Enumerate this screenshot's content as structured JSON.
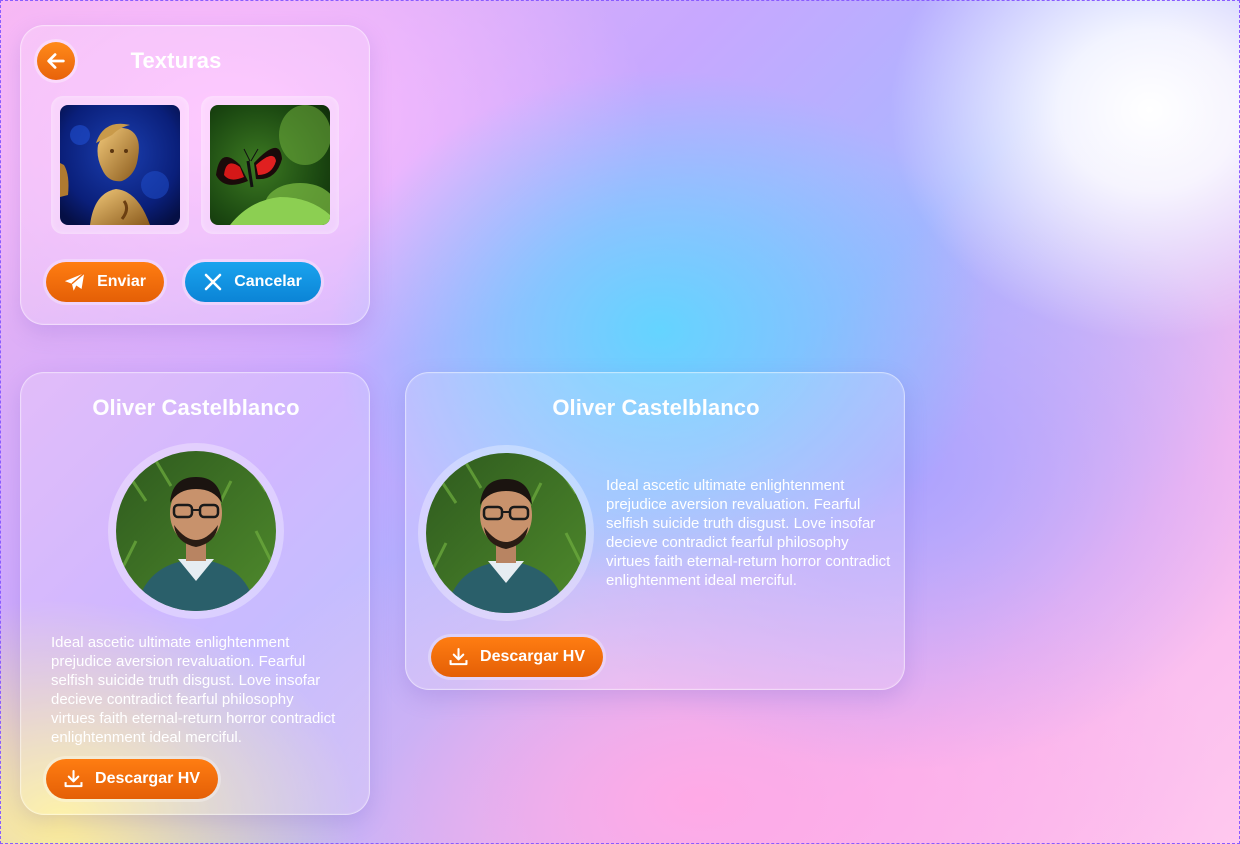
{
  "texturas": {
    "title": "Texturas",
    "send_label": "Enviar",
    "cancel_label": "Cancelar",
    "images": [
      "statue-image",
      "butterfly-image"
    ]
  },
  "profile_vertical": {
    "name": "Oliver Castelblanco",
    "bio": "Ideal ascetic ultimate enlightenment prejudice aversion revaluation. Fearful selfish suicide truth disgust. Love insofar decieve contradict fearful philosophy virtues faith eternal-return horror contradict enlightenment ideal merciful.",
    "download_label": "Descargar HV"
  },
  "profile_horizontal": {
    "name": "Oliver Castelblanco",
    "bio": "Ideal ascetic ultimate enlightenment prejudice aversion revaluation. Fearful selfish suicide truth disgust. Love insofar decieve contradict fearful philosophy virtues faith eternal-return horror contradict enlightenment ideal merciful.",
    "download_label": "Descargar HV"
  },
  "colors": {
    "accent_orange": "#ef6a0c",
    "accent_blue": "#0f92e0"
  },
  "icons": [
    "arrow-left-icon",
    "paper-plane-icon",
    "close-icon",
    "download-icon"
  ]
}
